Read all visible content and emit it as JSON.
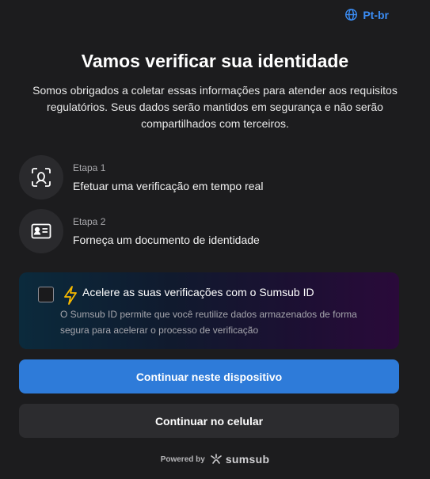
{
  "language": {
    "label": "Pt-br",
    "icon": "globe-icon"
  },
  "header": {
    "title": "Vamos verificar sua identidade",
    "subtitle": "Somos obrigados a coletar essas informações para atender aos requisitos regulatórios. Seus dados serão mantidos em segurança e não serão compartilhados com terceiros."
  },
  "steps": [
    {
      "label": "Etapa 1",
      "description": "Efetuar uma verificação em tempo real",
      "icon": "face-scan-icon"
    },
    {
      "label": "Etapa 2",
      "description": "Forneça um documento de identidade",
      "icon": "id-card-icon"
    }
  ],
  "promo": {
    "title": "Acelere as suas verificações com o Sumsub ID",
    "description": "O Sumsub ID permite que você reutilize dados armazenados de forma segura para acelerar o processo de verificação",
    "icon": "lightning-icon",
    "checked": false
  },
  "buttons": {
    "primary": "Continuar neste dispositivo",
    "secondary": "Continuar no celular"
  },
  "footer": {
    "powered_by": "Powered by",
    "brand": "sumsub"
  },
  "colors": {
    "background": "#1c1c1e",
    "accent": "#2e7bd9",
    "link": "#3b8df5",
    "bolt": "#f5b800"
  }
}
